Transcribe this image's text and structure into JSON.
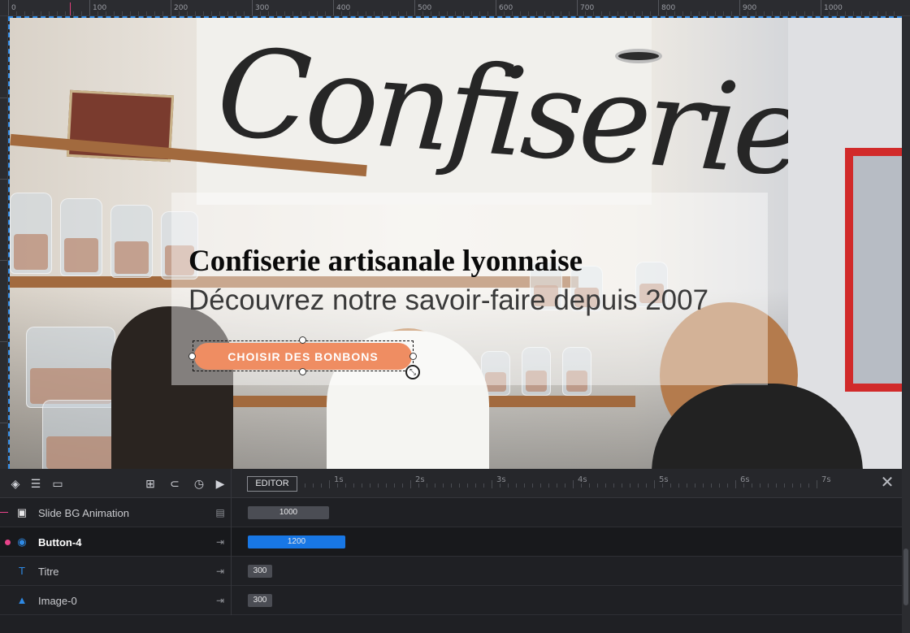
{
  "ruler": {
    "labels": [
      "0",
      "100",
      "200",
      "300",
      "400",
      "500",
      "600",
      "700",
      "800",
      "900",
      "1000"
    ]
  },
  "slide": {
    "title": "Confiserie artisanale lyonnaise",
    "subtitle": "Découvrez notre savoir-faire depuis 2007",
    "button_label": "CHOISIR DES BONBONS",
    "colors": {
      "button": "#ef8d62",
      "selection": "#2f8ae5"
    }
  },
  "timeline": {
    "editor_label": "EDITOR",
    "time_marks": [
      "1s",
      "2s",
      "3s",
      "4s",
      "5s",
      "6s",
      "7s"
    ],
    "rows": [
      {
        "label": "Slide BG Animation",
        "icon": "image-icon",
        "duration": "1000",
        "color": "#4b4d54"
      },
      {
        "label": "Button-4",
        "icon": "button-icon",
        "duration": "1200",
        "color": "#1877e5",
        "active": true
      },
      {
        "label": "Titre",
        "icon": "text-icon",
        "duration": "300",
        "color": "#4b4d54"
      },
      {
        "label": "Image-0",
        "icon": "image-layer-icon",
        "duration": "300",
        "color": "#4b4d54"
      }
    ]
  }
}
